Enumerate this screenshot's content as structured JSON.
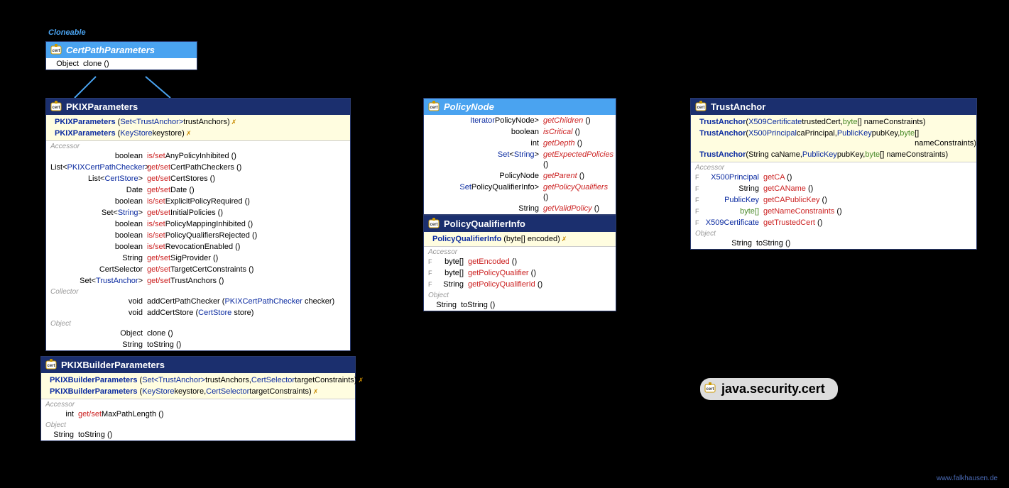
{
  "stereotype": "Cloneable",
  "package": "java.security.cert",
  "footer": "www.falkhausen.de",
  "certPathParameters": {
    "title": "CertPathParameters",
    "rows": [
      {
        "ret": "Object",
        "name": "clone",
        "params": "()"
      }
    ]
  },
  "pkixParameters": {
    "title": "PKIXParameters",
    "ctors": [
      {
        "name": "PKIXParameters",
        "params_prefix": "(",
        "param_type": "Set<TrustAnchor>",
        "params_suffix": " trustAnchors)",
        "exc": "✗"
      },
      {
        "name": "PKIXParameters",
        "params_prefix": "(",
        "param_type": "KeyStore",
        "params_suffix": " keystore)",
        "exc": "✗"
      }
    ],
    "accessor": [
      {
        "ret": "boolean",
        "getset": "is/set",
        "m": "AnyPolicyInhibited",
        "params": "()"
      },
      {
        "ret_html": "List<PKIXCertPathChecker>",
        "getset": "get/set",
        "m": "CertPathCheckers",
        "params": "()"
      },
      {
        "ret_html": "List<CertStore>",
        "getset": "get/set",
        "m": "CertStores",
        "params": "()"
      },
      {
        "ret": "Date",
        "getset": "get/set",
        "m": "Date",
        "params": "()"
      },
      {
        "ret": "boolean",
        "getset": "is/set",
        "m": "ExplicitPolicyRequired",
        "params": "()"
      },
      {
        "ret_html": "Set<String>",
        "getset": "get/set",
        "m": "InitialPolicies",
        "params": "()"
      },
      {
        "ret": "boolean",
        "getset": "is/set",
        "m": "PolicyMappingInhibited",
        "params": "()"
      },
      {
        "ret": "boolean",
        "getset": "is/set",
        "m": "PolicyQualifiersRejected",
        "params": "()"
      },
      {
        "ret": "boolean",
        "getset": "is/set",
        "m": "RevocationEnabled",
        "params": "()"
      },
      {
        "ret": "String",
        "getset": "get/set",
        "m": "SigProvider",
        "params": "()"
      },
      {
        "ret": "CertSelector",
        "getset": "get/set",
        "m": "TargetCertConstraints",
        "params": "()"
      },
      {
        "ret_html": "Set<TrustAnchor>",
        "getset": "get/set",
        "m": "TrustAnchors",
        "params": "()"
      }
    ],
    "collector": [
      {
        "ret": "void",
        "m": "addCertPathChecker",
        "param_type": "PKIXCertPathChecker",
        "param_name": "checker"
      },
      {
        "ret": "void",
        "m": "addCertStore",
        "param_type": "CertStore",
        "param_name": "store"
      }
    ],
    "object": [
      {
        "ret": "Object",
        "m": "clone",
        "params": "()"
      },
      {
        "ret": "String",
        "m": "toString",
        "params": "()"
      }
    ]
  },
  "pkixBuilderParameters": {
    "title": "PKIXBuilderParameters",
    "ctors": [
      {
        "name": "PKIXBuilderParameters",
        "t1": "Set<TrustAnchor>",
        "n1": "trustAnchors",
        "t2": "CertSelector",
        "n2": "targetConstraints",
        "exc": "✗"
      },
      {
        "name": "PKIXBuilderParameters",
        "t1": "KeyStore",
        "n1": "keystore",
        "t2": "CertSelector",
        "n2": "targetConstraints",
        "exc": "✗"
      }
    ],
    "accessor": [
      {
        "ret": "int",
        "getset": "get/set",
        "m": "MaxPathLength",
        "params": "()"
      }
    ],
    "object": [
      {
        "ret": "String",
        "m": "toString",
        "params": "()"
      }
    ]
  },
  "policyNode": {
    "title": "PolicyNode",
    "rows": [
      {
        "ret_html": "Iterator<? extends PolicyNode>",
        "m": "getChildren",
        "params": "()"
      },
      {
        "ret": "boolean",
        "m": "isCritical",
        "params": "()"
      },
      {
        "ret": "int",
        "m": "getDepth",
        "params": "()"
      },
      {
        "ret_html": "Set<String>",
        "m": "getExpectedPolicies",
        "params": "()"
      },
      {
        "ret": "PolicyNode",
        "m": "getParent",
        "params": "()"
      },
      {
        "ret_html": "Set<? extends PolicyQualifierInfo>",
        "m": "getPolicyQualifiers",
        "params": "()"
      },
      {
        "ret": "String",
        "m": "getValidPolicy",
        "params": "()"
      }
    ]
  },
  "policyQualifierInfo": {
    "title": "PolicyQualifierInfo",
    "ctors": [
      {
        "name": "PolicyQualifierInfo",
        "params": "(byte[] encoded)",
        "exc": "✗"
      }
    ],
    "accessor": [
      {
        "f": true,
        "ret": "byte[]",
        "m": "getEncoded",
        "params": "()"
      },
      {
        "f": true,
        "ret": "byte[]",
        "m": "getPolicyQualifier",
        "params": "()"
      },
      {
        "f": true,
        "ret": "String",
        "m": "getPolicyQualifierId",
        "params": "()"
      }
    ],
    "object": [
      {
        "ret": "String",
        "m": "toString",
        "params": "()"
      }
    ]
  },
  "trustAnchor": {
    "title": "TrustAnchor",
    "ctors": [
      {
        "name": "TrustAnchor",
        "parts": [
          [
            "X509Certificate",
            "blue"
          ],
          [
            " trustedCert, ",
            ""
          ],
          [
            "byte",
            ""
          ],
          [
            "[] nameConstraints)",
            "green-pre"
          ]
        ]
      },
      {
        "name": "TrustAnchor",
        "parts": [
          [
            "X500Principal",
            "blue"
          ],
          [
            " caPrincipal, ",
            ""
          ],
          [
            "PublicKey",
            "blue"
          ],
          [
            " pubKey, ",
            ""
          ],
          [
            "byte[]",
            "green"
          ],
          [
            " nameConstraints)",
            ""
          ]
        ]
      },
      {
        "name": "TrustAnchor",
        "parts": [
          [
            "String caName, ",
            ""
          ],
          [
            "PublicKey",
            "blue"
          ],
          [
            " pubKey, ",
            ""
          ],
          [
            "byte[]",
            "green"
          ],
          [
            " nameConstraints)",
            ""
          ]
        ]
      }
    ],
    "accessor": [
      {
        "f": true,
        "ret": "X500Principal",
        "ret_cls": "blue",
        "m": "getCA",
        "params": "()"
      },
      {
        "f": true,
        "ret": "String",
        "m": "getCAName",
        "params": "()"
      },
      {
        "f": true,
        "ret": "PublicKey",
        "ret_cls": "blue",
        "m": "getCAPublicKey",
        "params": "()"
      },
      {
        "f": true,
        "ret": "byte[]",
        "ret_cls": "green",
        "m": "getNameConstraints",
        "params": "()"
      },
      {
        "f": true,
        "ret": "X509Certificate",
        "ret_cls": "blue",
        "m": "getTrustedCert",
        "params": "()"
      }
    ],
    "object": [
      {
        "ret": "String",
        "m": "toString",
        "params": "()"
      }
    ]
  },
  "labels": {
    "accessor": "Accessor",
    "collector": "Collector",
    "object": "Object"
  }
}
